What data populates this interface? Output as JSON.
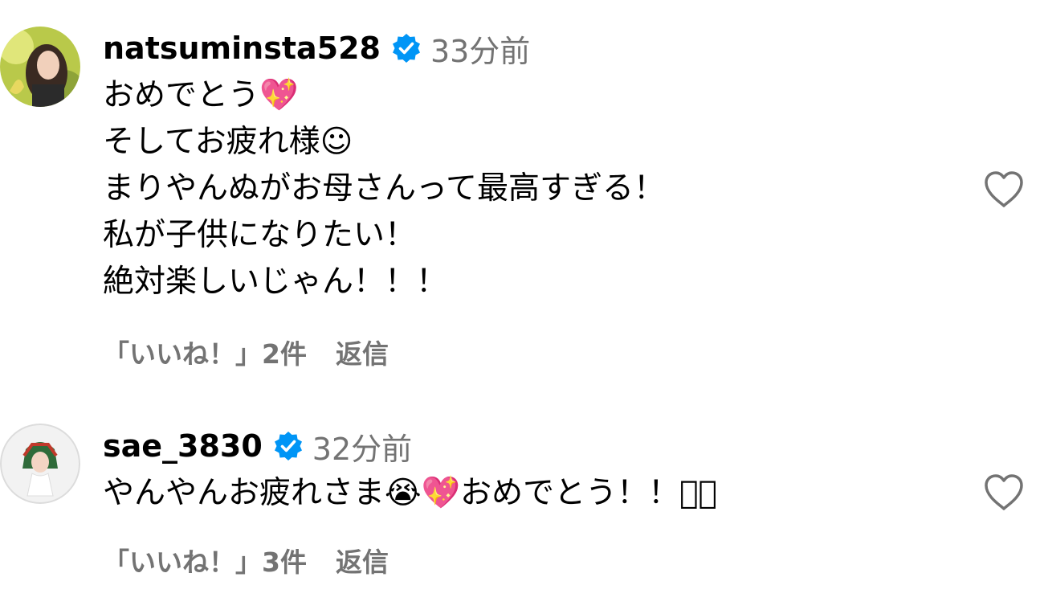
{
  "comments": [
    {
      "username": "natsuminsta528",
      "verified": true,
      "time": "33分前",
      "text": "おめでとう💖\nそしてお疲れ様☺\nまりやんぬがお母さんって最高すぎる！\n私が子供になりたい！\n絶対楽しいじゃん！！！",
      "likes": "「いいね！」2件",
      "reply": "返信"
    },
    {
      "username": "sae_3830",
      "verified": true,
      "time": "32分前",
      "text": "やんやんお疲れさま😭💖おめでとう！！􀀀􀀀",
      "likes": "「いいね！」3件",
      "reply": "返信"
    }
  ],
  "icons": {
    "verified": "verified-badge-icon",
    "like": "heart-outline-icon"
  },
  "colors": {
    "verified_blue": "#0095f6",
    "secondary_text": "#737373"
  }
}
